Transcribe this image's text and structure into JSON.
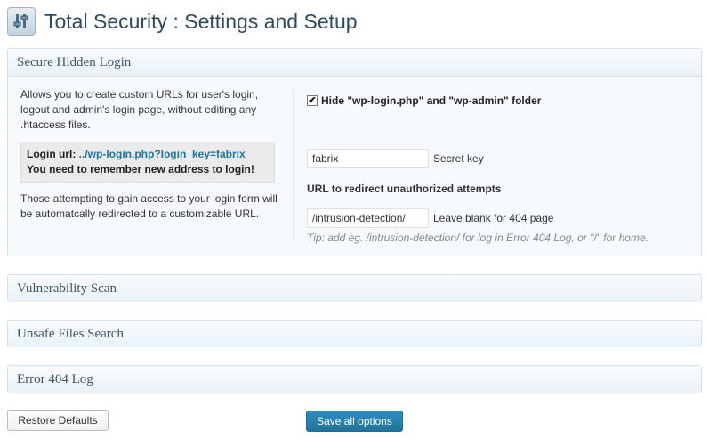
{
  "page": {
    "title": "Total Security : Settings and Setup",
    "icon": "sliders-icon"
  },
  "sections": {
    "secure_login": {
      "title": "Secure Hidden Login",
      "description": "Allows you to create custom URLs for user's login, logout and admin's login page, without editing any .htaccess files.",
      "login_url_label": "Login url:",
      "login_url": "../wp-login.php?login_key=fabrix",
      "remember_note": "You need to remember new address to login!",
      "redirect_note": "Those attempting to gain access to your login form will be automatcally redirected to a customizable URL.",
      "hide_checkbox": {
        "checked": true,
        "label": "Hide \"wp-login.php\" and \"wp-admin\" folder"
      },
      "secret_key": {
        "value": "fabrix",
        "label": "Secret key"
      },
      "redirect_heading": "URL to redirect unauthorized attempts",
      "redirect_url": {
        "value": "/intrusion-detection/",
        "label": "Leave blank for 404 page"
      },
      "tip": "Tip: add eg. /intrusion-detection/ for log in Error 404 Log, or \"/\" for home."
    },
    "vulnerability_scan": {
      "title": "Vulnerability Scan"
    },
    "unsafe_files": {
      "title": "Unsafe Files Search"
    },
    "error_404": {
      "title": "Error 404 Log"
    }
  },
  "buttons": {
    "restore": "Restore Defaults",
    "save": "Save all options"
  },
  "colors": {
    "primary_button": "#21759b",
    "link": "#21759b",
    "title": "#2d4b5f"
  }
}
